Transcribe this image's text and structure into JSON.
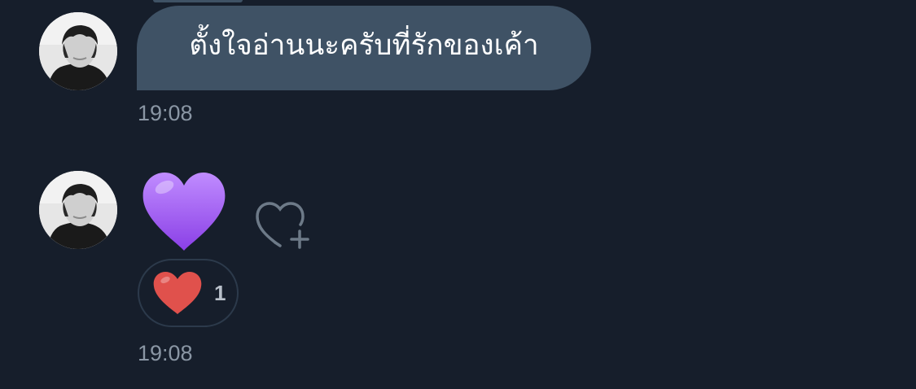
{
  "messages": [
    {
      "text": "ตั้งใจอ่านนะครับที่รักของเค้า",
      "time": "19:08"
    },
    {
      "emoji": "purple-heart",
      "reaction": {
        "emoji": "red-heart",
        "count": "1"
      },
      "time": "19:08"
    }
  ],
  "colors": {
    "background": "#161e2b",
    "bubble": "#3f5265",
    "timestamp": "#8a96a4",
    "reaction_border": "#2c3a4b",
    "purple_heart": "#a45cf2",
    "red_heart": "#e0514c"
  }
}
